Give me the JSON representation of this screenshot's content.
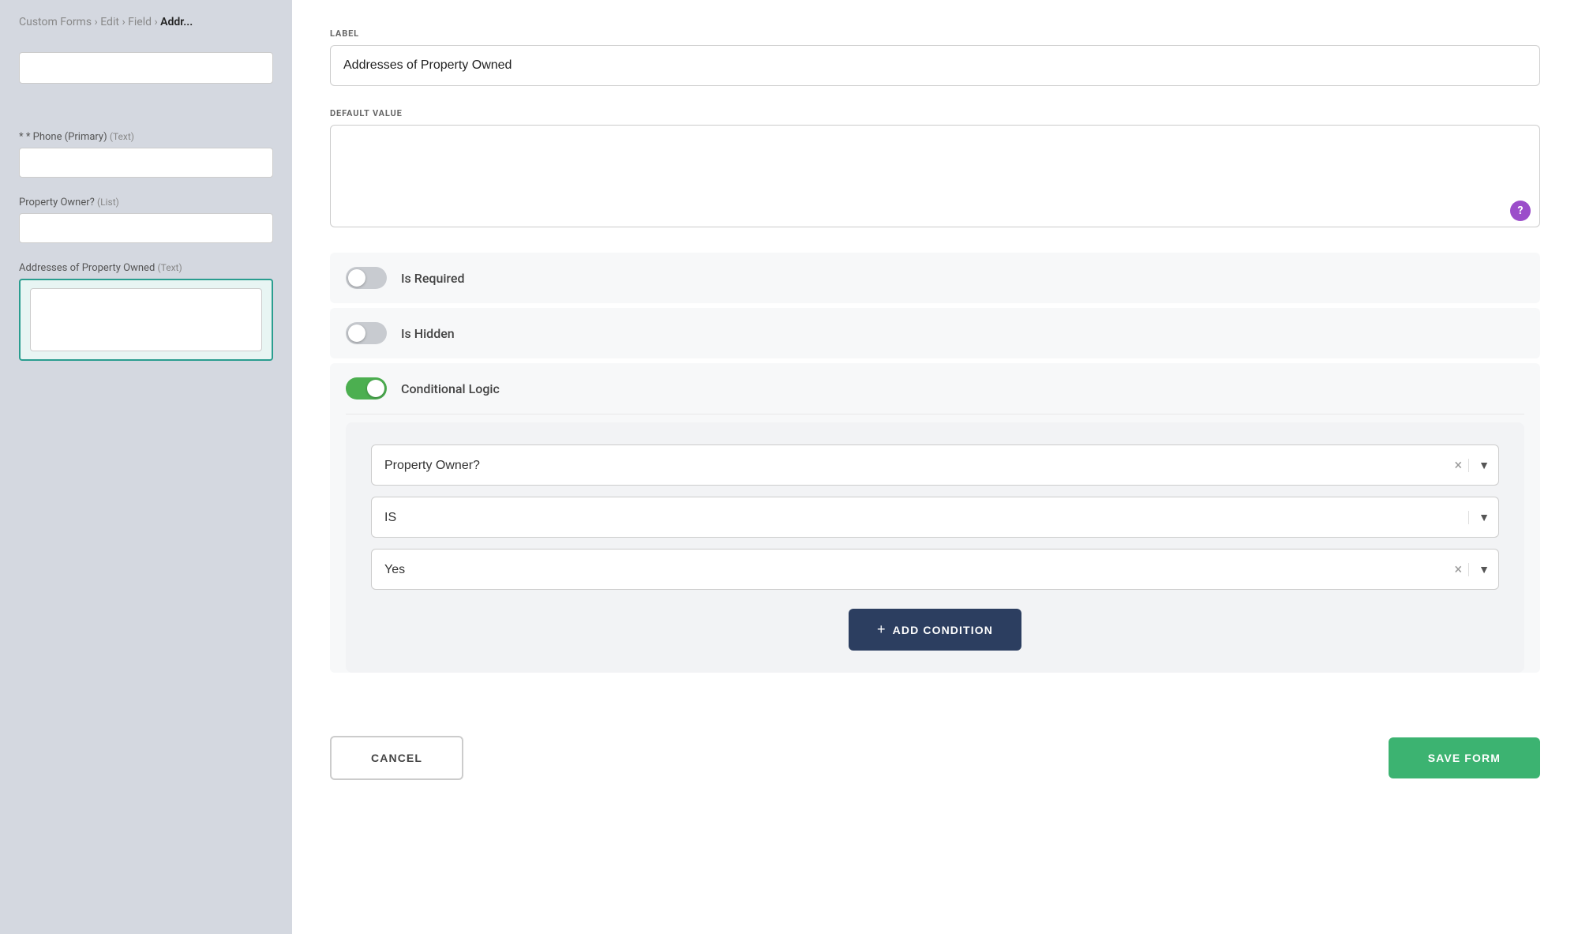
{
  "breadcrumb": {
    "items": [
      "Custom Forms",
      "Edit",
      "Field",
      "Addresses of Property Owned"
    ],
    "separators": [
      ">",
      ">",
      ">"
    ]
  },
  "background": {
    "phone_label": "* Phone (Primary)",
    "phone_type": "(Text)",
    "property_owner_label": "Property Owner?",
    "property_owner_type": "(List)",
    "addresses_label": "Addresses of Property Owned",
    "addresses_type": "(Text)"
  },
  "form": {
    "label_field_label": "LABEL",
    "label_value": "Addresses of Property Owned",
    "default_value_label": "DEFAULT VALUE",
    "default_value_placeholder": "",
    "help_icon": "?",
    "is_required_label": "Is Required",
    "is_hidden_label": "Is Hidden",
    "conditional_logic_label": "Conditional Logic",
    "conditional_logic_on": true,
    "is_required_on": false,
    "is_hidden_on": false
  },
  "conditional_logic": {
    "field_select_value": "Property Owner?",
    "field_select_placeholder": "Property Owner?",
    "operator_select_value": "IS",
    "value_select_value": "Yes",
    "add_condition_label": "ADD CONDITION",
    "plus_symbol": "+"
  },
  "footer": {
    "cancel_label": "CANCEL",
    "save_label": "SAVE FORM"
  },
  "colors": {
    "toggle_active": "#4CAF50",
    "toggle_inactive": "#c8cbd0",
    "add_condition_bg": "#2c3e60",
    "save_btn_bg": "#3cb371"
  }
}
